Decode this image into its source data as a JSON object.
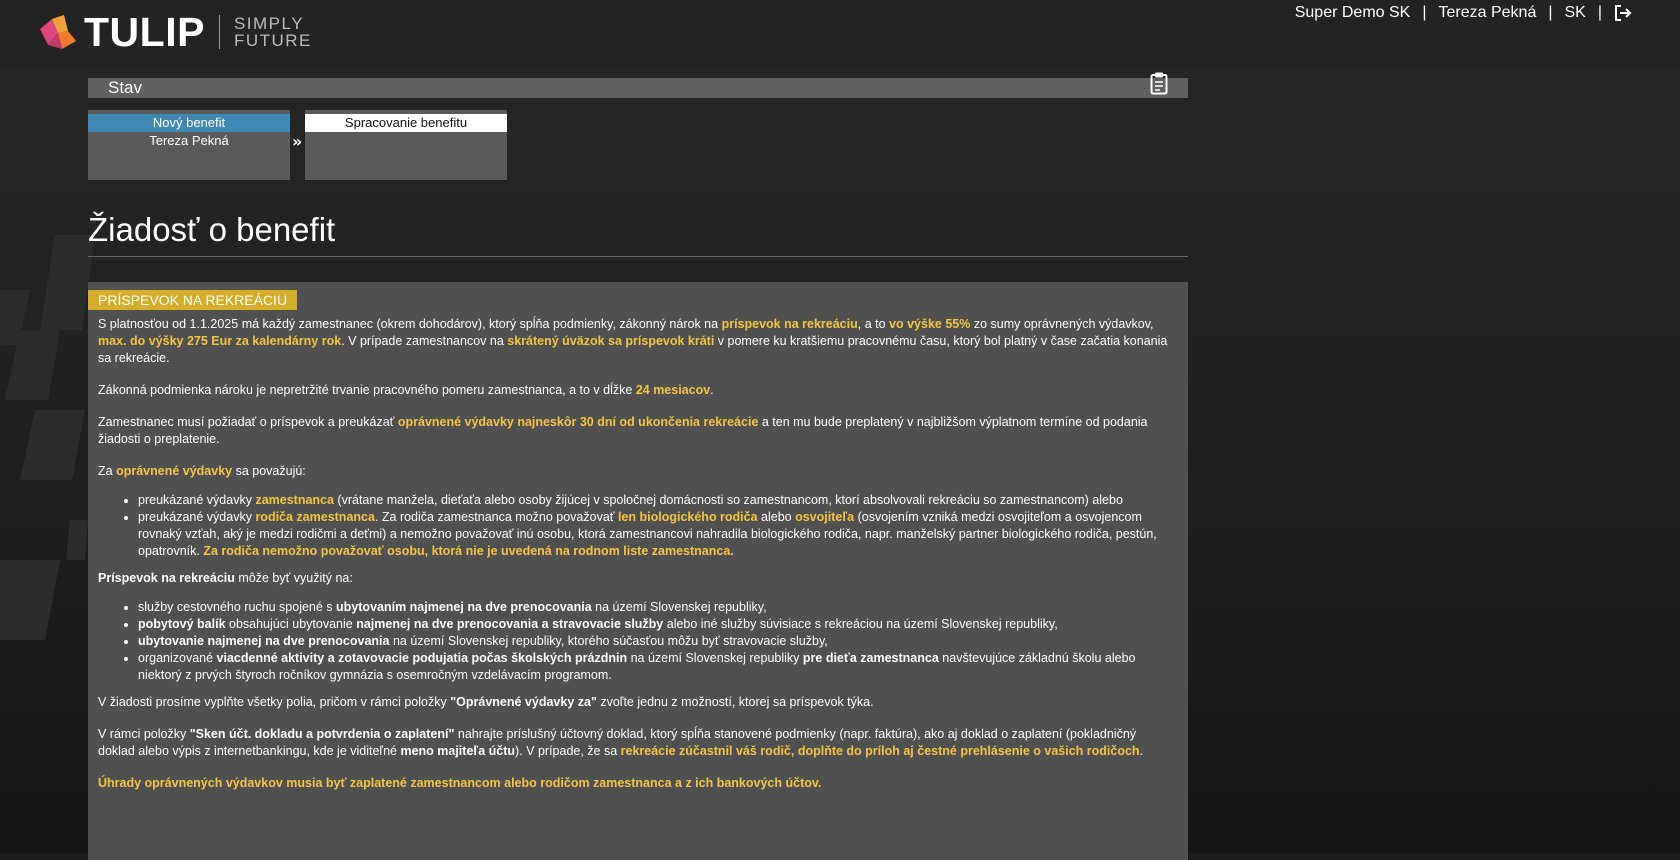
{
  "header": {
    "brand": "TULIP",
    "tagline_1": "SIMPLY",
    "tagline_2": "FUTURE",
    "company": "Super Demo SK",
    "user": "Tereza Pekná",
    "language": "SK",
    "separator": "|"
  },
  "status_bar": {
    "label": "Stav"
  },
  "workflow": {
    "steps": [
      {
        "title": "Nový benefit",
        "subtitle": "Tereza Pekná"
      },
      {
        "title": "Spracovanie benefitu",
        "subtitle": ""
      }
    ],
    "arrow": "»"
  },
  "page": {
    "title": "Žiadosť o benefit"
  },
  "section": {
    "badge": "PRÍSPEVOK NA REKREÁCIU",
    "p1": {
      "t1": "S platnosťou od 1.1.2025 má každý zamestnanec (okrem dohodárov), ktorý spĺňa podmienky, zákonný nárok na ",
      "h1": "príspevok na rekreáciu",
      "t2": ", a to ",
      "h2": "vo výške 55%",
      "t3": " zo sumy oprávnených výdavkov, ",
      "h3": "max. do výšky 275 Eur za kalendárny rok",
      "t4": ". V prípade zamestnancov na ",
      "h4": "skrátený úväzok sa príspevok kráti",
      "t5": " v pomere ku kratšiemu pracovnému času, ktorý bol platný v čase začatia konania sa rekreácie."
    },
    "p2": {
      "t1": "Zákonná podmienka nároku je nepretržité trvanie pracovného pomeru zamestnanca, a to v dĺžke ",
      "h1": "24 mesiacov",
      "t2": "."
    },
    "p3": {
      "t1": "Zamestnanec musí požiadať o príspevok a preukázať ",
      "h1": "oprávnené výdavky najneskôr 30 dní od ukončenia rekreácie",
      "t2": " a ten mu bude preplatený v najbližšom výplatnom termíne od podania žiadosti o preplatenie."
    },
    "p4": {
      "t1": "Za ",
      "h1": "oprávnené výdavky",
      "t2": " sa považujú:"
    },
    "list1": {
      "i1": {
        "t1": "preukázané výdavky ",
        "h1": "zamestnanca",
        "t2": " (vrátane manžela, dieťaťa alebo osoby žijúcej v spoločnej domácnosti so zamestnancom, ktorí absolvovali rekreáciu so zamestnancom) alebo"
      },
      "i2": {
        "t1": "preukázané výdavky ",
        "h1": "rodiča zamestnanca",
        "t2": ". Za rodiča zamestnanca možno považovať ",
        "h2": "len biologického rodiča",
        "t3": " alebo ",
        "h3": "osvojiteľa",
        "t4": " (osvojením vzniká medzi osvojiteľom a osvojencom rovnaký vzťah, aký je medzi rodičmi a deťmi) a nemožno považovať inú osobu, ktorá zamestnancovi nahradila biologického rodiča, napr. manželský partner biologického rodiča, pestún, opatrovník. ",
        "h4": "Za rodiča nemožno považovať osobu, ktorá nie je uvedená na rodnom liste zamestnanca."
      }
    },
    "p5": {
      "b1": "Príspevok na rekreáciu",
      "t1": " môže byť využitý na:"
    },
    "list2": {
      "i1": {
        "t1": "služby cestovného ruchu spojené s ",
        "b1": "ubytovaním najmenej na dve prenocovania",
        "t2": " na území Slovenskej republiky,"
      },
      "i2": {
        "b1": "pobytový balík",
        "t1": " obsahujúci ubytovanie ",
        "b2": "najmenej na dve prenocovania a stravovacie služby",
        "t2": " alebo iné služby súvisiace s rekreáciou na území Slovenskej republiky,"
      },
      "i3": {
        "b1": "ubytovanie najmenej na dve prenocovania",
        "t1": " na území Slovenskej republiky, ktorého súčasťou môžu byť stravovacie služby,"
      },
      "i4": {
        "t1": "organizované ",
        "b1": "viacdenné aktivity a zotavovacie podujatia počas školských prázdnin",
        "t2": " na území Slovenskej republiky ",
        "b2": "pre dieťa zamestnanca",
        "t3": " navštevujúce základnú školu alebo niektorý z prvých štyroch ročníkov gymnázia s osemročným vzdelávacím programom."
      }
    },
    "p6": {
      "t1": "V žiadosti prosíme vyplňte všetky polia, pričom v rámci položky ",
      "b1": "\"Oprávnené výdavky za\"",
      "t2": " zvoľte jednu z možností, ktorej sa príspevok týka."
    },
    "p7": {
      "t1": "V rámci položky ",
      "b1": "\"Sken účt. dokladu a potvrdenia o zaplatení\"",
      "t2": " nahrajte príslušný účtovný doklad, ktorý spĺňa stanovené podmienky (napr. faktúra), ako aj doklad o zaplatení (pokladničný doklad alebo výpis z internetbankingu, kde je viditeľné ",
      "b2": "meno majiteľa účtu",
      "t3": "). V prípade, že sa ",
      "h1": "rekreácie zúčastnil váš rodič, doplňte do príloh aj čestné prehlásenie o vašich rodičoch",
      "t4": "."
    },
    "p8": {
      "h1": "Úhrady oprávnených výdavkov musia byť zaplatené zamestnancom alebo rodičom zamestnanca a z ich bankových účtov."
    }
  },
  "colors": {
    "accent": "#f5c542",
    "badge": "#d5ad2a",
    "step_active": "#3f88b3",
    "panel": "#505050"
  },
  "icons": {
    "logo": "tulip-logo-icon",
    "logout": "logout-icon",
    "clipboard": "clipboard-icon"
  }
}
